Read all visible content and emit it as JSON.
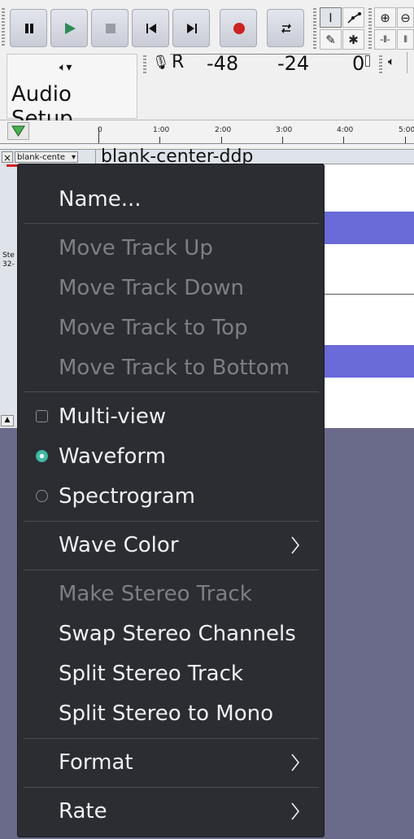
{
  "toolbar": {
    "audio_setup_label": "Audio Setup",
    "meter_ticks": [
      "-48",
      "-24",
      "0"
    ],
    "meter_r": "R"
  },
  "timeline": {
    "ticks": [
      "0",
      "1:00",
      "2:00",
      "3:00",
      "4:00",
      "5:00"
    ]
  },
  "track": {
    "name_dropdown": "blank-cente",
    "title": "blank-center-ddp",
    "info_line1": "Ste",
    "info_line2": "32-"
  },
  "menu": {
    "items": [
      {
        "label": "Name...",
        "enabled": true
      },
      {
        "label": "Move Track Up",
        "enabled": false
      },
      {
        "label": "Move Track Down",
        "enabled": false
      },
      {
        "label": "Move Track to Top",
        "enabled": false
      },
      {
        "label": "Move Track to Bottom",
        "enabled": false
      },
      {
        "label": "Multi-view",
        "enabled": true,
        "type": "checkbox",
        "checked": false
      },
      {
        "label": "Waveform",
        "enabled": true,
        "type": "radio",
        "checked": true
      },
      {
        "label": "Spectrogram",
        "enabled": true,
        "type": "radio",
        "checked": false
      },
      {
        "label": "Wave Color",
        "enabled": true,
        "submenu": true
      },
      {
        "label": "Make Stereo Track",
        "enabled": false
      },
      {
        "label": "Swap Stereo Channels",
        "enabled": true
      },
      {
        "label": "Split Stereo Track",
        "enabled": true
      },
      {
        "label": "Split Stereo to Mono",
        "enabled": true
      },
      {
        "label": "Format",
        "enabled": true,
        "submenu": true
      },
      {
        "label": "Rate",
        "enabled": true,
        "submenu": true
      }
    ]
  },
  "colors": {
    "menu_bg": "#2b2d33",
    "menu_text": "#eef0f2",
    "menu_disabled": "#7c7f86",
    "radio_accent": "#3fb8a4",
    "waveform_band": "#6a6ad8",
    "record_red": "#cc2222",
    "play_green": "#2e8b57"
  }
}
